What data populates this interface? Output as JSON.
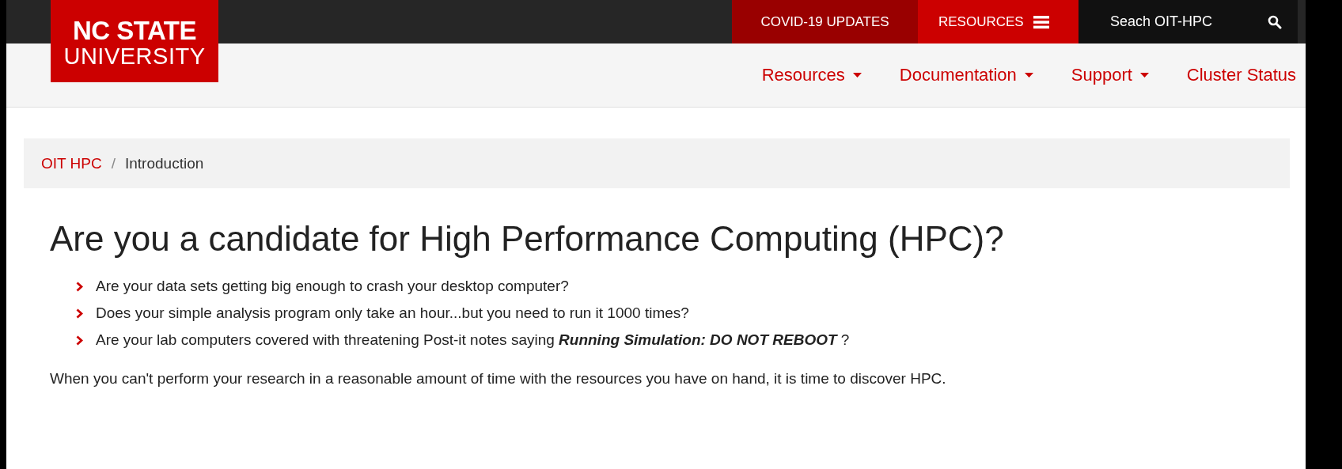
{
  "header": {
    "logo": {
      "line_1": "NC STATE",
      "line_2": "UNIVERSITY"
    },
    "utility_links": [
      {
        "label": "COVID-19 UPDATES",
        "kind": "link"
      },
      {
        "label": "RESOURCES",
        "kind": "menu"
      }
    ],
    "search": {
      "placeholder": "Seach OIT-HPC"
    },
    "nav": [
      {
        "label": "Resources",
        "dropdown": true
      },
      {
        "label": "Documentation",
        "dropdown": true
      },
      {
        "label": "Support",
        "dropdown": true
      },
      {
        "label": "Cluster Status",
        "dropdown": false
      }
    ]
  },
  "breadcrumb_separator": "/",
  "breadcrumb": [
    {
      "label": "OIT HPC",
      "link": true
    },
    {
      "label": "Introduction",
      "link": false
    }
  ],
  "heading": "Are you a candidate for High Performance Computing (HPC)?",
  "bullets": [
    "Are your data sets getting big enough to crash your desktop computer?",
    "Does your simple analysis program only take an hour...but you need to run it 1000 times?",
    "Are your lab computers covered with threatening Post-it notes saying **Running Simulation: DO NOT REBOOT** ?"
  ],
  "paragraph": "When you can't perform your research in a reasonable amount of time with the resources you have on hand, it is time to discover HPC."
}
